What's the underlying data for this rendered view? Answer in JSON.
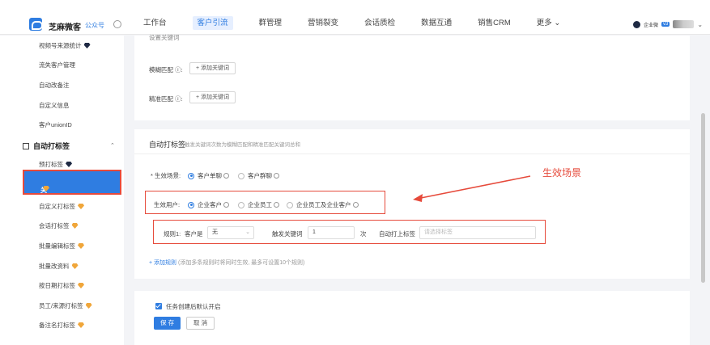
{
  "header": {
    "brand": "芝麻微客",
    "brand_tag": "公众号",
    "nav": [
      "工作台",
      "客户引流",
      "群管理",
      "营销裂变",
      "会话质检",
      "数据互通",
      "销售CRM",
      "更多 ⌄"
    ],
    "active_nav": "客户引流",
    "enterprise_label": "企业微",
    "version_badge": "v3",
    "dropdown_icon": "chevron-down-icon"
  },
  "sidebar": {
    "items_top": [
      "视频号来源统计",
      "流失客户管理",
      "自动改备注",
      "自定义信息",
      "客户unionID"
    ],
    "group": "自动打标签",
    "group_caret": "⌃",
    "items": [
      "预打标签",
      "关键词打标签",
      "自定义打标签",
      "会话打标签",
      "批量编辑标签",
      "批量改资料",
      "按日期打标签",
      "员工/来源打标签",
      "备注名打标签"
    ],
    "active": "关键词打标签"
  },
  "keywords": {
    "fuzzy_label": "模糊匹配 ⓘ:",
    "exact_label": "精准匹配 ⓘ:",
    "add_keyword": "+ 添加关键词",
    "cut_off_label": "设置关键词"
  },
  "auto_tag": {
    "title": "自动打标签",
    "subtitle": "触发关键词次数为模糊匹配和精准匹配关键词总和",
    "scene_label": "* 生效场景:",
    "scene_options": [
      "客户单聊",
      "客户群聊"
    ],
    "scene_selected": 0,
    "user_label": "生效用户:",
    "user_options": [
      "企业客户",
      "企业员工",
      "企业员工及企业客户"
    ],
    "user_selected": 0,
    "rule": {
      "label": "规则1:",
      "customer_field": "客户是",
      "customer_value": "无",
      "trigger_label": "触发关键词",
      "trigger_count": "1",
      "times_unit": "次",
      "auto_tag_label": "自动打上标签",
      "tag_placeholder": "请选择标签"
    },
    "add_rule_link": "+ 添加规则",
    "add_rule_hint": "(添加多条规则时将同时生效, 最多可设置10个规则)",
    "annotation": "生效场景"
  },
  "footer": {
    "checkbox_label": "任务创建后默认开启",
    "save": "保 存",
    "cancel": "取 消"
  },
  "colors": {
    "accent": "#2f7de1",
    "annotation_red": "#e64a3b"
  }
}
